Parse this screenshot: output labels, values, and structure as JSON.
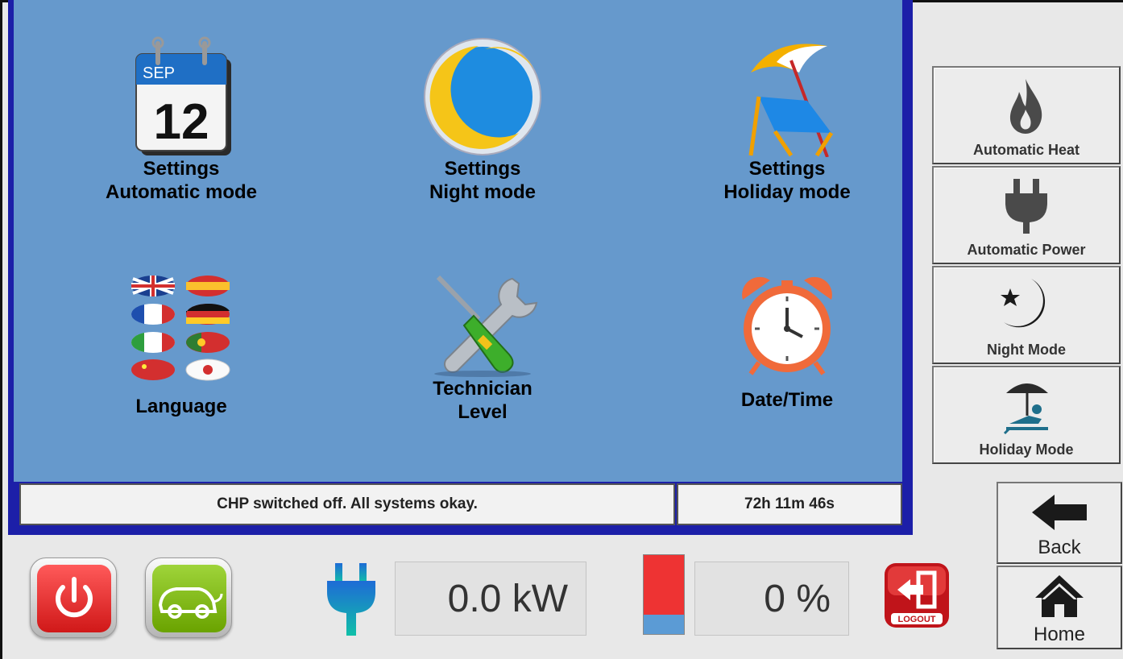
{
  "tiles": [
    {
      "name": "settings-automatic-mode",
      "label": "Settings\nAutomatic mode",
      "icon": "calendar-icon",
      "calendar_month": "SEP",
      "calendar_day": "12"
    },
    {
      "name": "settings-night-mode",
      "label": "Settings\nNight mode",
      "icon": "moon-icon"
    },
    {
      "name": "settings-holiday-mode",
      "label": "Settings\nHoliday mode",
      "icon": "beach-chair-icon"
    },
    {
      "name": "language",
      "label": "Language",
      "icon": "flags-icon"
    },
    {
      "name": "technician-level",
      "label": "Technician\nLevel",
      "icon": "tools-icon"
    },
    {
      "name": "date-time",
      "label": "Date/Time",
      "icon": "alarm-clock-icon"
    }
  ],
  "status": {
    "message": "CHP switched off. All systems okay.",
    "runtime": "72h 11m 46s"
  },
  "side_buttons": [
    {
      "name": "automatic-heat",
      "label": "Automatic Heat",
      "icon": "flame-icon"
    },
    {
      "name": "automatic-power",
      "label": "Automatic Power",
      "icon": "plug-icon"
    },
    {
      "name": "night-mode",
      "label": "Night Mode",
      "icon": "moon-star-icon"
    },
    {
      "name": "holiday-mode",
      "label": "Holiday Mode",
      "icon": "sunbather-icon"
    }
  ],
  "nav": {
    "back_label": "Back",
    "home_label": "Home"
  },
  "bottom": {
    "power_value": "0.0 kW",
    "level_value": "0 %",
    "level_fraction": 0.0,
    "logout_label": "LOGOUT"
  },
  "colors": {
    "panel_bg": "#6699cc",
    "panel_border": "#1c1fa8",
    "power_button": "#e02020",
    "ev_button": "#7ab800",
    "level_red": "#ee3333",
    "level_blue": "#5b9bd5"
  }
}
